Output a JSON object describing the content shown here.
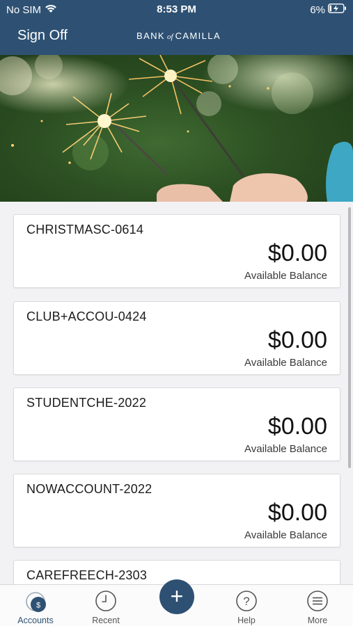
{
  "status_bar": {
    "carrier": "No SIM",
    "time": "8:53 PM",
    "battery_percent": "6%"
  },
  "nav": {
    "sign_off_label": "Sign Off",
    "brand_left": "BANK",
    "brand_of": "of",
    "brand_right": "CAMILLA"
  },
  "accounts": [
    {
      "name": "CHRISTMASC-0614",
      "balance": "$0.00",
      "balance_label": "Available Balance"
    },
    {
      "name": "CLUB+ACCOU-0424",
      "balance": "$0.00",
      "balance_label": "Available Balance"
    },
    {
      "name": "STUDENTCHE-2022",
      "balance": "$0.00",
      "balance_label": "Available Balance"
    },
    {
      "name": "NOWACCOUNT-2022",
      "balance": "$0.00",
      "balance_label": "Available Balance"
    },
    {
      "name": "CAREFREECH-2303",
      "balance": "",
      "balance_label": ""
    }
  ],
  "tabbar": {
    "accounts_label": "Accounts",
    "accounts_badge": "$",
    "recent_label": "Recent",
    "add_glyph": "+",
    "help_label": "Help",
    "help_glyph": "?",
    "more_label": "More"
  },
  "colors": {
    "header": "#2e5173",
    "background": "#f2f2f4",
    "card": "#ffffff"
  }
}
